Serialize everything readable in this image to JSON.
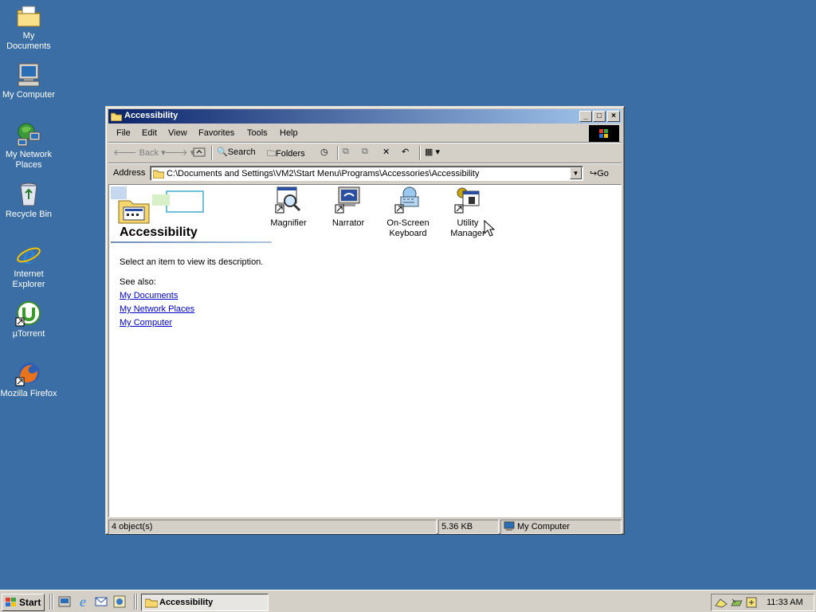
{
  "desktop": {
    "icons": [
      {
        "label": "My Documents",
        "icon": "my-documents-icon"
      },
      {
        "label": "My Computer",
        "icon": "my-computer-icon"
      },
      {
        "label": "My Network Places",
        "icon": "network-places-icon"
      },
      {
        "label": "Recycle Bin",
        "icon": "recycle-bin-icon"
      },
      {
        "label": "Internet Explorer",
        "icon": "internet-explorer-icon"
      },
      {
        "label": "µTorrent",
        "icon": "utorrent-icon"
      },
      {
        "label": "Mozilla Firefox",
        "icon": "firefox-icon"
      }
    ],
    "background_color": "#3a6ea5"
  },
  "window": {
    "title": "Accessibility",
    "menu": [
      "File",
      "Edit",
      "View",
      "Favorites",
      "Tools",
      "Help"
    ],
    "toolbar": {
      "back": "Back",
      "search": "Search",
      "folders": "Folders"
    },
    "address": {
      "label": "Address",
      "value": "C:\\Documents and Settings\\VM2\\Start Menu\\Programs\\Accessories\\Accessibility",
      "go": "Go"
    },
    "panel": {
      "folder_title": "Accessibility",
      "description": "Select an item to view its description.",
      "see_also": "See also:",
      "links": [
        "My Documents",
        "My Network Places",
        "My Computer"
      ]
    },
    "items": [
      {
        "label_line1": "Magnifier",
        "label_line2": "",
        "icon": "magnifier-icon"
      },
      {
        "label_line1": "Narrator",
        "label_line2": "",
        "icon": "narrator-icon"
      },
      {
        "label_line1": "On-Screen",
        "label_line2": "Keyboard",
        "icon": "keyboard-icon"
      },
      {
        "label_line1": "Utility",
        "label_line2": "Manager",
        "icon": "utility-manager-icon"
      }
    ],
    "status": {
      "objects": "4 object(s)",
      "size": "5.36 KB",
      "location": "My Computer"
    }
  },
  "taskbar": {
    "start_label": "Start",
    "tasks": [
      {
        "label": "Accessibility",
        "active": true
      }
    ],
    "clock": "11:33 AM"
  }
}
